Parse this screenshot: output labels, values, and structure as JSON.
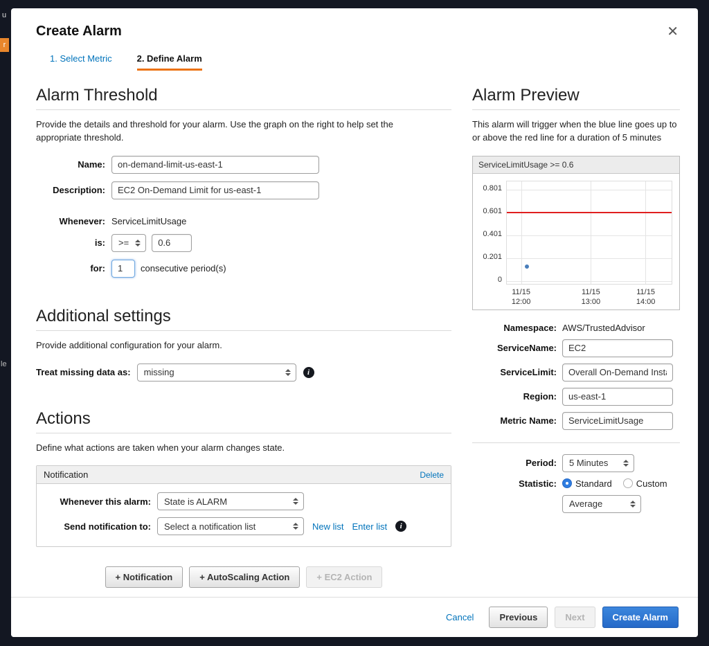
{
  "colors": {
    "link_blue": "#0073bb",
    "accent_orange": "#ec7211",
    "primary_button_blue": "#2d72c8",
    "threshold_red": "#e01f1f",
    "radio_blue": "#2f7de1"
  },
  "edge_fragments": {
    "top": "u",
    "mid": "r",
    "bottom": "le"
  },
  "modal": {
    "title": "Create Alarm",
    "close": "✕"
  },
  "steps": {
    "select_metric": "1. Select Metric",
    "define_alarm": "2. Define Alarm"
  },
  "threshold": {
    "heading": "Alarm Threshold",
    "description": "Provide the details and threshold for your alarm. Use the graph on the right to help set the appropriate threshold.",
    "name_label": "Name:",
    "name_value": "on-demand-limit-us-east-1",
    "description_label": "Description:",
    "description_value": "EC2 On-Demand Limit for us-east-1",
    "whenever_label": "Whenever:",
    "whenever_value": "ServiceLimitUsage",
    "is_label": "is:",
    "operator_value": ">=",
    "threshold_value": "0.6",
    "for_label": "for:",
    "periods_value": "1",
    "periods_suffix": "consecutive period(s)"
  },
  "additional": {
    "heading": "Additional settings",
    "description": "Provide additional configuration for your alarm.",
    "missing_label": "Treat missing data as:",
    "missing_value": "missing"
  },
  "actions": {
    "heading": "Actions",
    "description": "Define what actions are taken when your alarm changes state.",
    "notification_header": "Notification",
    "delete_label": "Delete",
    "whenever_label": "Whenever this alarm:",
    "state_value": "State is ALARM",
    "send_label": "Send notification to:",
    "send_value": "Select a notification list",
    "new_list_label": "New list",
    "enter_list_label": "Enter list",
    "add_notification_label": "+ Notification",
    "add_autoscaling_label": "+ AutoScaling Action",
    "add_ec2_label": "+ EC2 Action"
  },
  "preview": {
    "heading": "Alarm Preview",
    "description": "This alarm will trigger when the blue line goes up to or above the red line for a duration of 5 minutes",
    "namespace_label": "Namespace:",
    "namespace_value": "AWS/TrustedAdvisor",
    "servicename_label": "ServiceName:",
    "servicename_value": "EC2",
    "servicelimit_label": "ServiceLimit:",
    "servicelimit_value": "Overall On-Demand Instances",
    "region_label": "Region:",
    "region_value": "us-east-1",
    "metricname_label": "Metric Name:",
    "metricname_value": "ServiceLimitUsage",
    "period_label": "Period:",
    "period_value": "5 Minutes",
    "statistic_label": "Statistic:",
    "standard_label": "Standard",
    "custom_label": "Custom",
    "statistic_select_value": "Average"
  },
  "chart_data": {
    "type": "line",
    "title": "ServiceLimitUsage >= 0.6",
    "xlabel": "",
    "ylabel": "",
    "ylim": [
      0,
      0.88
    ],
    "grid": true,
    "y_ticks": [
      "0.801",
      "0.601",
      "0.401",
      "0.201",
      "0"
    ],
    "x_ticks": [
      {
        "date": "11/15",
        "time": "12:00"
      },
      {
        "date": "11/15",
        "time": "13:00"
      },
      {
        "date": "11/15",
        "time": "14:00"
      }
    ],
    "threshold_line": {
      "value": 0.6,
      "color": "#e01f1f"
    },
    "series": [
      {
        "name": "ServiceLimitUsage",
        "color": "#4a7ebb",
        "points": [
          {
            "x": "11/15 12:00",
            "y": 0.13
          }
        ]
      }
    ]
  },
  "footer": {
    "cancel_label": "Cancel",
    "previous_label": "Previous",
    "next_label": "Next",
    "create_label": "Create Alarm"
  }
}
